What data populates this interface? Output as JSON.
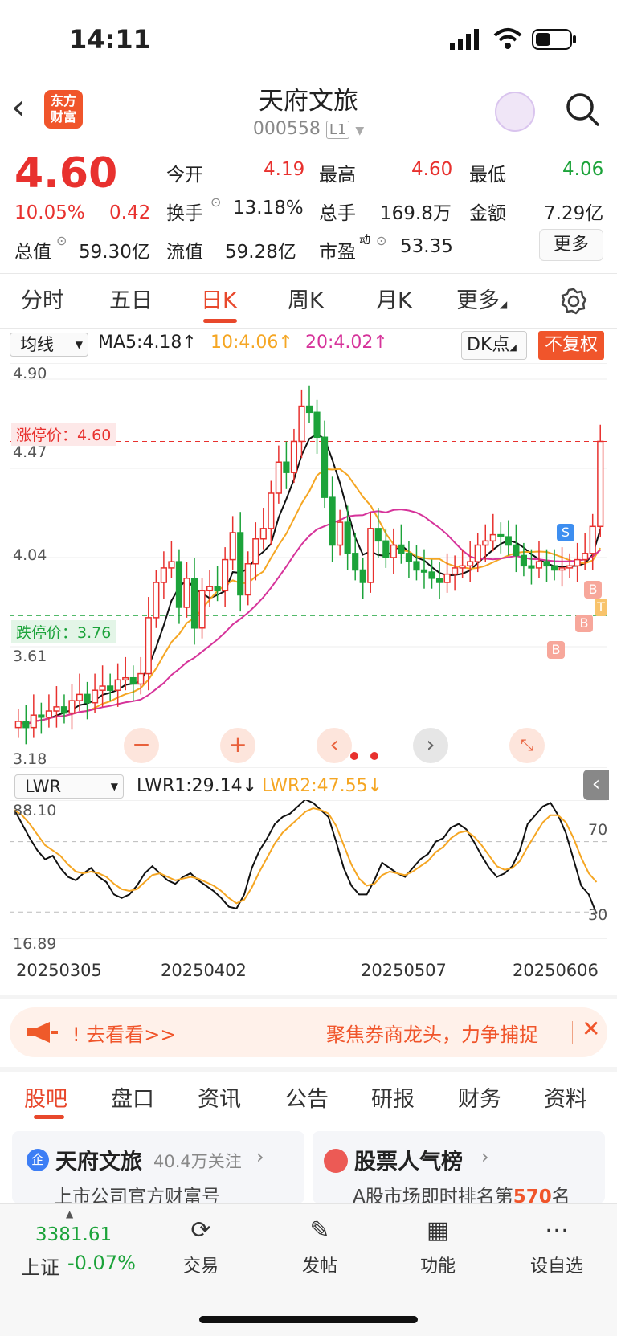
{
  "status": {
    "time": "14:11"
  },
  "header": {
    "logo_line1": "东方",
    "logo_line2": "财富",
    "name": "天府文旅",
    "code": "000558",
    "level": "L1"
  },
  "quote": {
    "price": "4.60",
    "change_pct": "10.05%",
    "change": "0.42",
    "open_label": "今开",
    "open": "4.19",
    "high_label": "最高",
    "high": "4.60",
    "low_label": "最低",
    "low": "4.06",
    "turnover_label": "换手",
    "turnover": "13.18%",
    "volume_label": "总手",
    "volume": "169.8万",
    "amount_label": "金额",
    "amount": "7.29亿",
    "mktcap_label": "总值",
    "mktcap": "59.30亿",
    "float_label": "流值",
    "float": "59.28亿",
    "pe_label": "市盈",
    "pe_sup": "动",
    "pe": "53.35",
    "more": "更多"
  },
  "tabs": [
    "分时",
    "五日",
    "日K",
    "周K",
    "月K",
    "更多"
  ],
  "indicators": {
    "ma_select": "均线",
    "ma5": "MA5:4.18↑",
    "ma10": "10:4.06↑",
    "ma20": "20:4.02↑",
    "dk": "DK点",
    "adjust": "不复权",
    "price_labels": [
      "4.90",
      "4.47",
      "4.04",
      "3.61",
      "3.18"
    ],
    "limit_up": "涨停价：4.60",
    "limit_down": "跌停价：3.76",
    "lwr_select": "LWR",
    "lwr1": "LWR1:29.14↓",
    "lwr2": "LWR2:47.55↓",
    "lwr_labels": [
      "88.10",
      "16.89"
    ],
    "lwr_right": [
      "70",
      "30"
    ],
    "dates": [
      "20250305",
      "20250402",
      "20250507",
      "20250606"
    ],
    "marker_s": "S",
    "marker_b": "B",
    "marker_t": "T"
  },
  "colors": {
    "up": "#e8312e",
    "down": "#1ca33a",
    "ma10": "#f5a623",
    "ma20": "#d6339a",
    "accent": "#f0552b"
  },
  "chart_data": {
    "type": "candlestick",
    "y_range": [
      3.18,
      4.9
    ],
    "close": [
      3.25,
      3.22,
      3.28,
      3.27,
      3.3,
      3.32,
      3.29,
      3.35,
      3.38,
      3.34,
      3.4,
      3.42,
      3.4,
      3.45,
      3.46,
      3.43,
      3.48,
      3.75,
      3.92,
      3.99,
      4.02,
      3.8,
      3.94,
      3.7,
      3.88,
      3.9,
      3.88,
      4.03,
      4.16,
      3.86,
      4.01,
      4.13,
      4.18,
      4.35,
      4.5,
      4.45,
      4.6,
      4.77,
      4.74,
      4.62,
      4.33,
      4.1,
      4.21,
      4.06,
      3.98,
      3.92,
      4.18,
      4.12,
      4.04,
      4.1,
      4.06,
      4.02,
      3.98,
      3.97,
      3.94,
      3.92,
      3.96,
      3.99,
      4.0,
      4.02,
      4.1,
      4.12,
      4.15,
      4.14,
      4.1,
      4.05,
      4.0,
      3.99,
      4.02,
      4.0,
      3.98,
      3.99,
      4.0,
      4.03,
      4.06,
      4.19,
      4.6
    ],
    "lwr1": [
      88,
      80,
      72,
      65,
      60,
      62,
      55,
      50,
      48,
      52,
      55,
      50,
      47,
      40,
      38,
      40,
      45,
      52,
      56,
      52,
      48,
      46,
      50,
      52,
      48,
      45,
      42,
      38,
      33,
      32,
      40,
      55,
      65,
      72,
      80,
      84,
      86,
      90,
      94,
      92,
      88,
      84,
      70,
      55,
      45,
      40,
      40,
      48,
      58,
      55,
      52,
      50,
      55,
      60,
      63,
      70,
      72,
      78,
      80,
      77,
      70,
      62,
      55,
      50,
      52,
      56,
      65,
      80,
      85,
      90,
      92,
      85,
      75,
      60,
      45,
      40,
      29
    ],
    "lwr2": [
      88,
      85,
      80,
      74,
      68,
      65,
      62,
      57,
      53,
      52,
      53,
      52,
      50,
      46,
      43,
      42,
      43,
      47,
      51,
      52,
      50,
      48,
      49,
      50,
      49,
      47,
      45,
      42,
      38,
      35,
      37,
      44,
      53,
      61,
      69,
      75,
      79,
      83,
      87,
      89,
      88,
      86,
      79,
      68,
      57,
      49,
      45,
      46,
      51,
      53,
      52,
      51,
      53,
      56,
      59,
      64,
      67,
      72,
      75,
      76,
      73,
      68,
      62,
      56,
      54,
      55,
      59,
      67,
      74,
      81,
      85,
      85,
      81,
      72,
      61,
      52,
      47
    ]
  },
  "banner": {
    "text1": "去看看>>",
    "text2": "聚焦券商龙头，力争捕捉"
  },
  "bottom_tabs": [
    "股吧",
    "盘口",
    "资讯",
    "公告",
    "研报",
    "财务",
    "资料"
  ],
  "cards": {
    "c1_title": "天府文旅",
    "c1_follow": "40.4万关注",
    "c1_sub": "上市公司官方财富号",
    "c2_title": "股票人气榜",
    "c2_sub_pre": "A股市场即时排名第",
    "c2_rank": "570",
    "c2_sub_post": "名"
  },
  "nav": {
    "index_value": "3381.61",
    "index_name": "上证",
    "index_change": "-0.07%",
    "trade": "交易",
    "post": "发帖",
    "func": "功能",
    "watch": "设自选"
  }
}
